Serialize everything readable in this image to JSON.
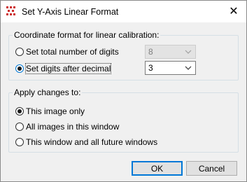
{
  "window": {
    "title": "Set Y-Axis Linear Format",
    "close_symbol": "✕"
  },
  "format_group": {
    "label": "Coordinate format for linear calibration:",
    "options": [
      {
        "label": "Set total number of digits",
        "selected": false,
        "value": "8",
        "enabled": false
      },
      {
        "label": "Set digits after decimal",
        "selected": true,
        "value": "3",
        "enabled": true
      }
    ]
  },
  "apply_group": {
    "label": "Apply changes to:",
    "options": [
      {
        "label": "This image only",
        "selected": true
      },
      {
        "label": "All images in this window",
        "selected": false
      },
      {
        "label": "This window and all future windows",
        "selected": false
      }
    ]
  },
  "buttons": {
    "ok": "OK",
    "cancel": "Cancel"
  },
  "colors": {
    "accent": "#0078d7",
    "app_icon": "#cc2a2a"
  }
}
